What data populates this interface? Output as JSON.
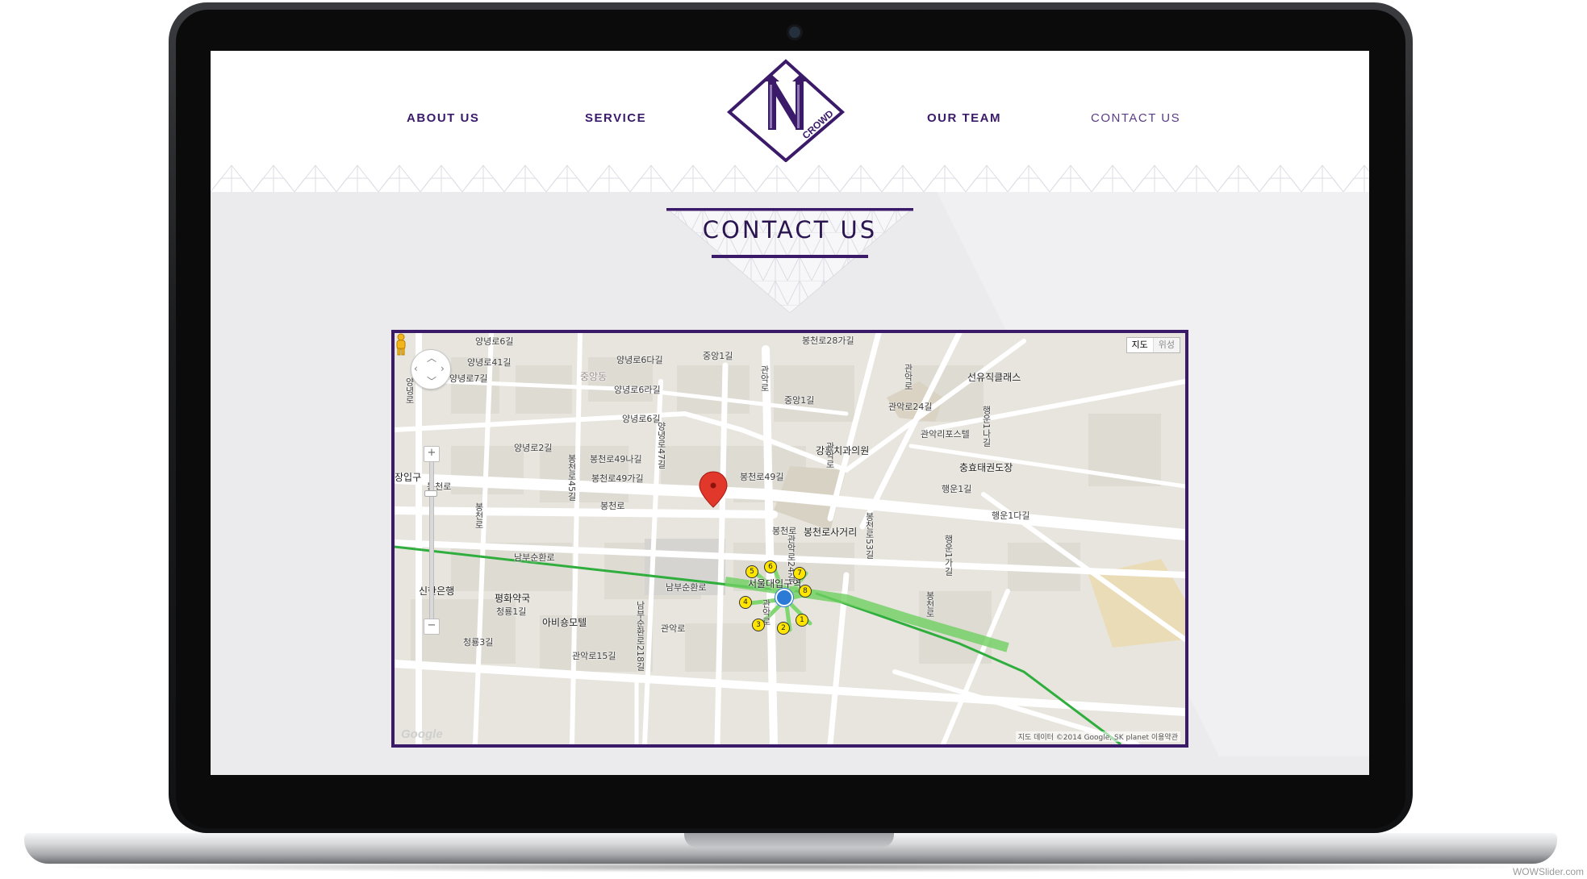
{
  "nav": {
    "about": "ABOUT US",
    "service": "SERVICE",
    "team": "OUR TEAM",
    "contact": "CONTACT US"
  },
  "logo": {
    "letter": "N",
    "word": "CROWD"
  },
  "page_title": "CONTACT US",
  "colors": {
    "brand": "#3b1a6a",
    "screen_bg": "#ebebed",
    "map_route": "#27a844",
    "marker": "#e2382b"
  },
  "map": {
    "type_buttons": [
      "지도",
      "위성"
    ],
    "labels": [
      "양녕로6길",
      "봉천로28가길",
      "양녕로6다길",
      "중앙1길",
      "중앙동",
      "양녕로41길",
      "양녕로7길",
      "양녕로6라길",
      "선유직클래스",
      "중앙1길",
      "양녕로6길",
      "관악로24길",
      "양녕로2길",
      "봉천로49나길",
      "강훈치과의원",
      "관악리포스텔",
      "봉천로49가길",
      "봉천로49길",
      "충효태권도장",
      "장입구",
      "봉천로",
      "봉천로",
      "봉천로",
      "봉천로사거리",
      "남부순환로",
      "남부순환로",
      "서울대입구역",
      "신한은행",
      "평화약국",
      "청룡1길",
      "아비숑모텔",
      "관악로",
      "청룡3길",
      "관악로15길",
      "행운1나길",
      "행운1길",
      "행운1다길",
      "봉천로53길",
      "관악로",
      "양녕로47길",
      "봉천로45길",
      "양녕로",
      "남부순환로218길",
      "봉천로",
      "관악로",
      "행운1가길",
      "관악로",
      "관악로24길",
      "봉천로",
      "관악로"
    ],
    "exits": [
      "1",
      "2",
      "3",
      "4",
      "5",
      "6",
      "7",
      "8"
    ],
    "attribution": "지도 데이터 ©2014 Google, SK planet    이용약관",
    "google": "Google"
  },
  "watermark": "WOWSlider.com"
}
